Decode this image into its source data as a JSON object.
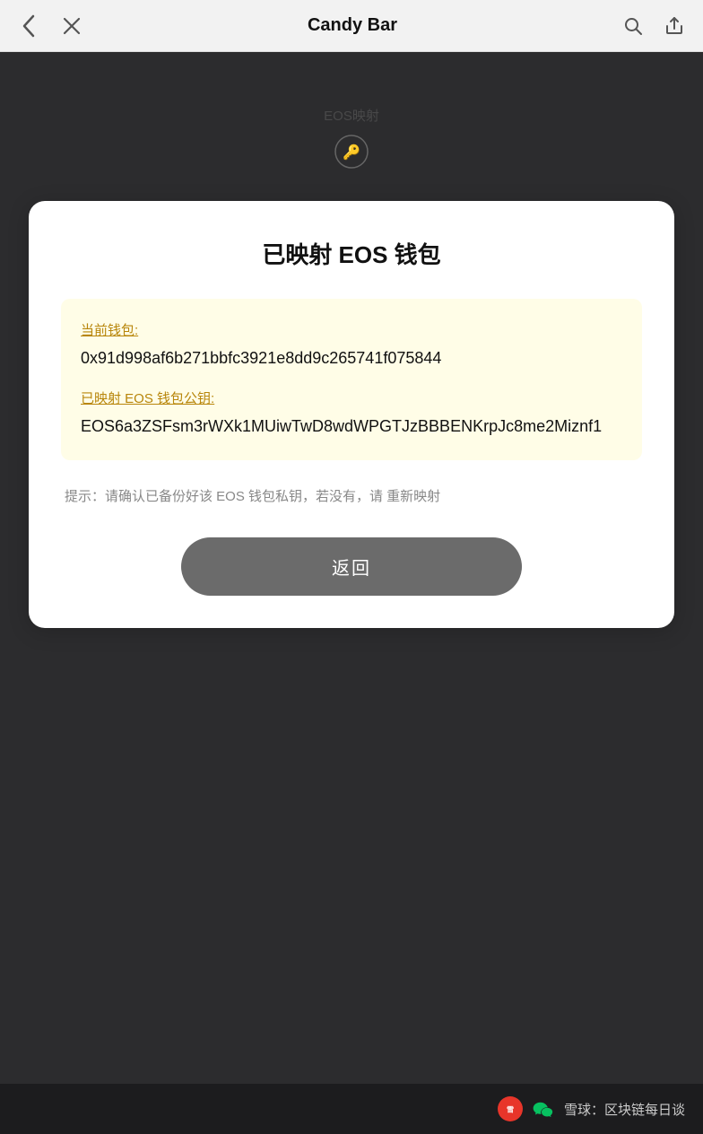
{
  "header": {
    "title": "Candy Bar",
    "back_label": "‹",
    "close_label": "✕"
  },
  "card": {
    "title": "已映射 EOS 钱包",
    "info_box": {
      "wallet_label": "当前钱包:",
      "wallet_value": "0x91d998af6b271bbfc3921e8dd9c265741f075844",
      "eos_label": "已映射 EOS 钱包公钥:",
      "eos_value": "EOS6a3ZSFsm3rWXk1MUiwTwD8wdWPGTJzBBBENKrpJc8me2Miznf1"
    },
    "hint": "提示：请确认已备份好该 EOS 钱包私钥，若没有，请 重新映射",
    "btn_return": "返回"
  },
  "footer": {
    "logo_alt": "雪球",
    "text": "雪球：区块链每日谈"
  }
}
